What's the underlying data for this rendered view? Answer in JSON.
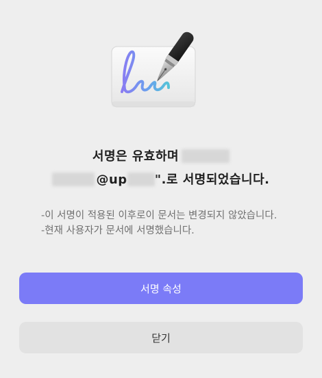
{
  "dialog": {
    "headline_line1": "서명은 유효하며",
    "headline_email_part": "@up",
    "headline_line2_suffix": "\".로 서명되었습니다.",
    "notes": [
      "-이 서명이 적용된 이후로이 문서는 변경되지 않았습니다.",
      "-현재 사용자가 문서에 서명했습니다."
    ],
    "primary_button_label": "서명 속성",
    "secondary_button_label": "닫기",
    "icon": "signature-pen-icon"
  },
  "colors": {
    "primary": "#7b7bf7",
    "secondary_bg": "#e2e2e2",
    "background": "#eeeeee"
  }
}
